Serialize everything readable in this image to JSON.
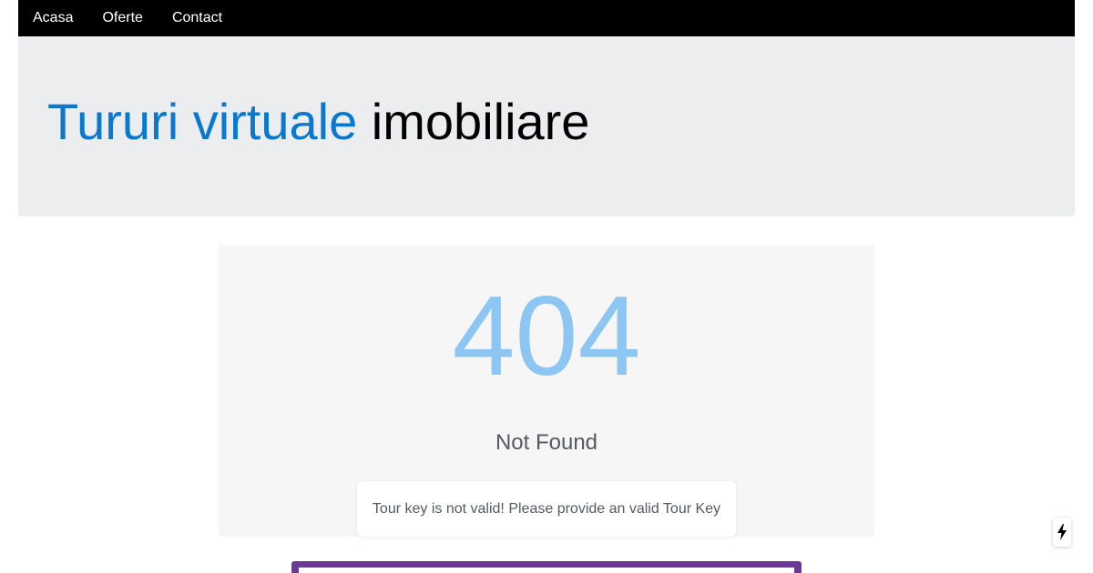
{
  "nav": {
    "items": [
      {
        "label": "Acasa"
      },
      {
        "label": "Oferte"
      },
      {
        "label": "Contact"
      }
    ]
  },
  "hero": {
    "title_accent": "Tururi virtuale",
    "title_rest": " imobiliare"
  },
  "error": {
    "code": "404",
    "title": "Not Found",
    "message": "Tour key is not valid! Please provide an valid Tour Key"
  },
  "colors": {
    "nav_bg": "#000000",
    "hero_bg": "#ecedef",
    "accent_blue": "#0b78d0",
    "error_code": "#8ec6f3",
    "frame_purple": "#6b3a97"
  },
  "icons": {
    "floating_action": "lightning-bolt-icon"
  }
}
